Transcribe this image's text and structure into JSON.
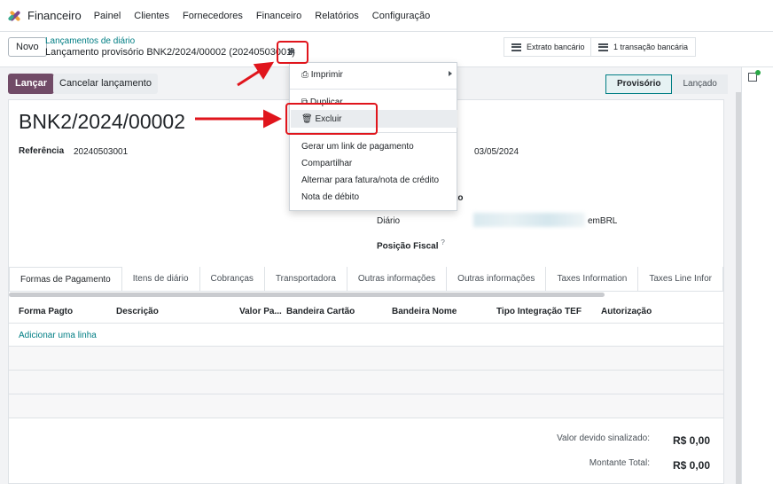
{
  "navbar": {
    "app_name": "Financeiro",
    "menu": [
      "Painel",
      "Clientes",
      "Fornecedores",
      "Financeiro",
      "Relatórios",
      "Configuração"
    ]
  },
  "control": {
    "new_label": "Novo",
    "breadcrumb_parent": "Lançamentos de diário",
    "breadcrumb_current": "Lançamento provisório BNK2/2024/00002 (20240503001)",
    "stat_bank_statement": "Extrato bancário",
    "stat_transactions": "1 transação bancária"
  },
  "actions": {
    "post_label": "Lançar",
    "cancel_label": "Cancelar lançamento",
    "status_current": "Provisório",
    "status_next": "Lançado"
  },
  "form": {
    "title": "BNK2/2024/00002",
    "reference_label": "Referência",
    "reference_value": "20240503001",
    "date_value": "03/05/2024",
    "partial_label": "to",
    "journal_label": "Diário",
    "journal_currency_prefix": "em",
    "journal_currency": "BRL",
    "fiscal_position_label": "Posição Fiscal",
    "fiscal_help": "?"
  },
  "tabs": [
    "Formas de Pagamento",
    "Itens de diário",
    "Cobranças",
    "Transportadora",
    "Outras informações",
    "Outras informações",
    "Taxes Information",
    "Taxes Line Infor"
  ],
  "table": {
    "columns": [
      "Forma Pagto",
      "Descrição",
      "Valor Pa...",
      "Bandeira Cartão",
      "Bandeira Nome",
      "Tipo Integração TEF",
      "Autorização"
    ],
    "add_line": "Adicionar uma linha"
  },
  "totals": {
    "signed_due_label": "Valor devido sinalizado:",
    "signed_due_value": "R$ 0,00",
    "total_label": "Montante Total:",
    "total_value": "R$ 0,00"
  },
  "dropdown": {
    "print": "Imprimir",
    "duplicate": "Duplicar",
    "delete": "Excluir",
    "payment_link": "Gerar um link de pagamento",
    "share": "Compartilhar",
    "switch_invoice": "Alternar para fatura/nota de crédito",
    "debit_note": "Nota de débito"
  },
  "colors": {
    "brand": "#714b67",
    "link": "#017e84",
    "annotation": "#e0151c"
  }
}
